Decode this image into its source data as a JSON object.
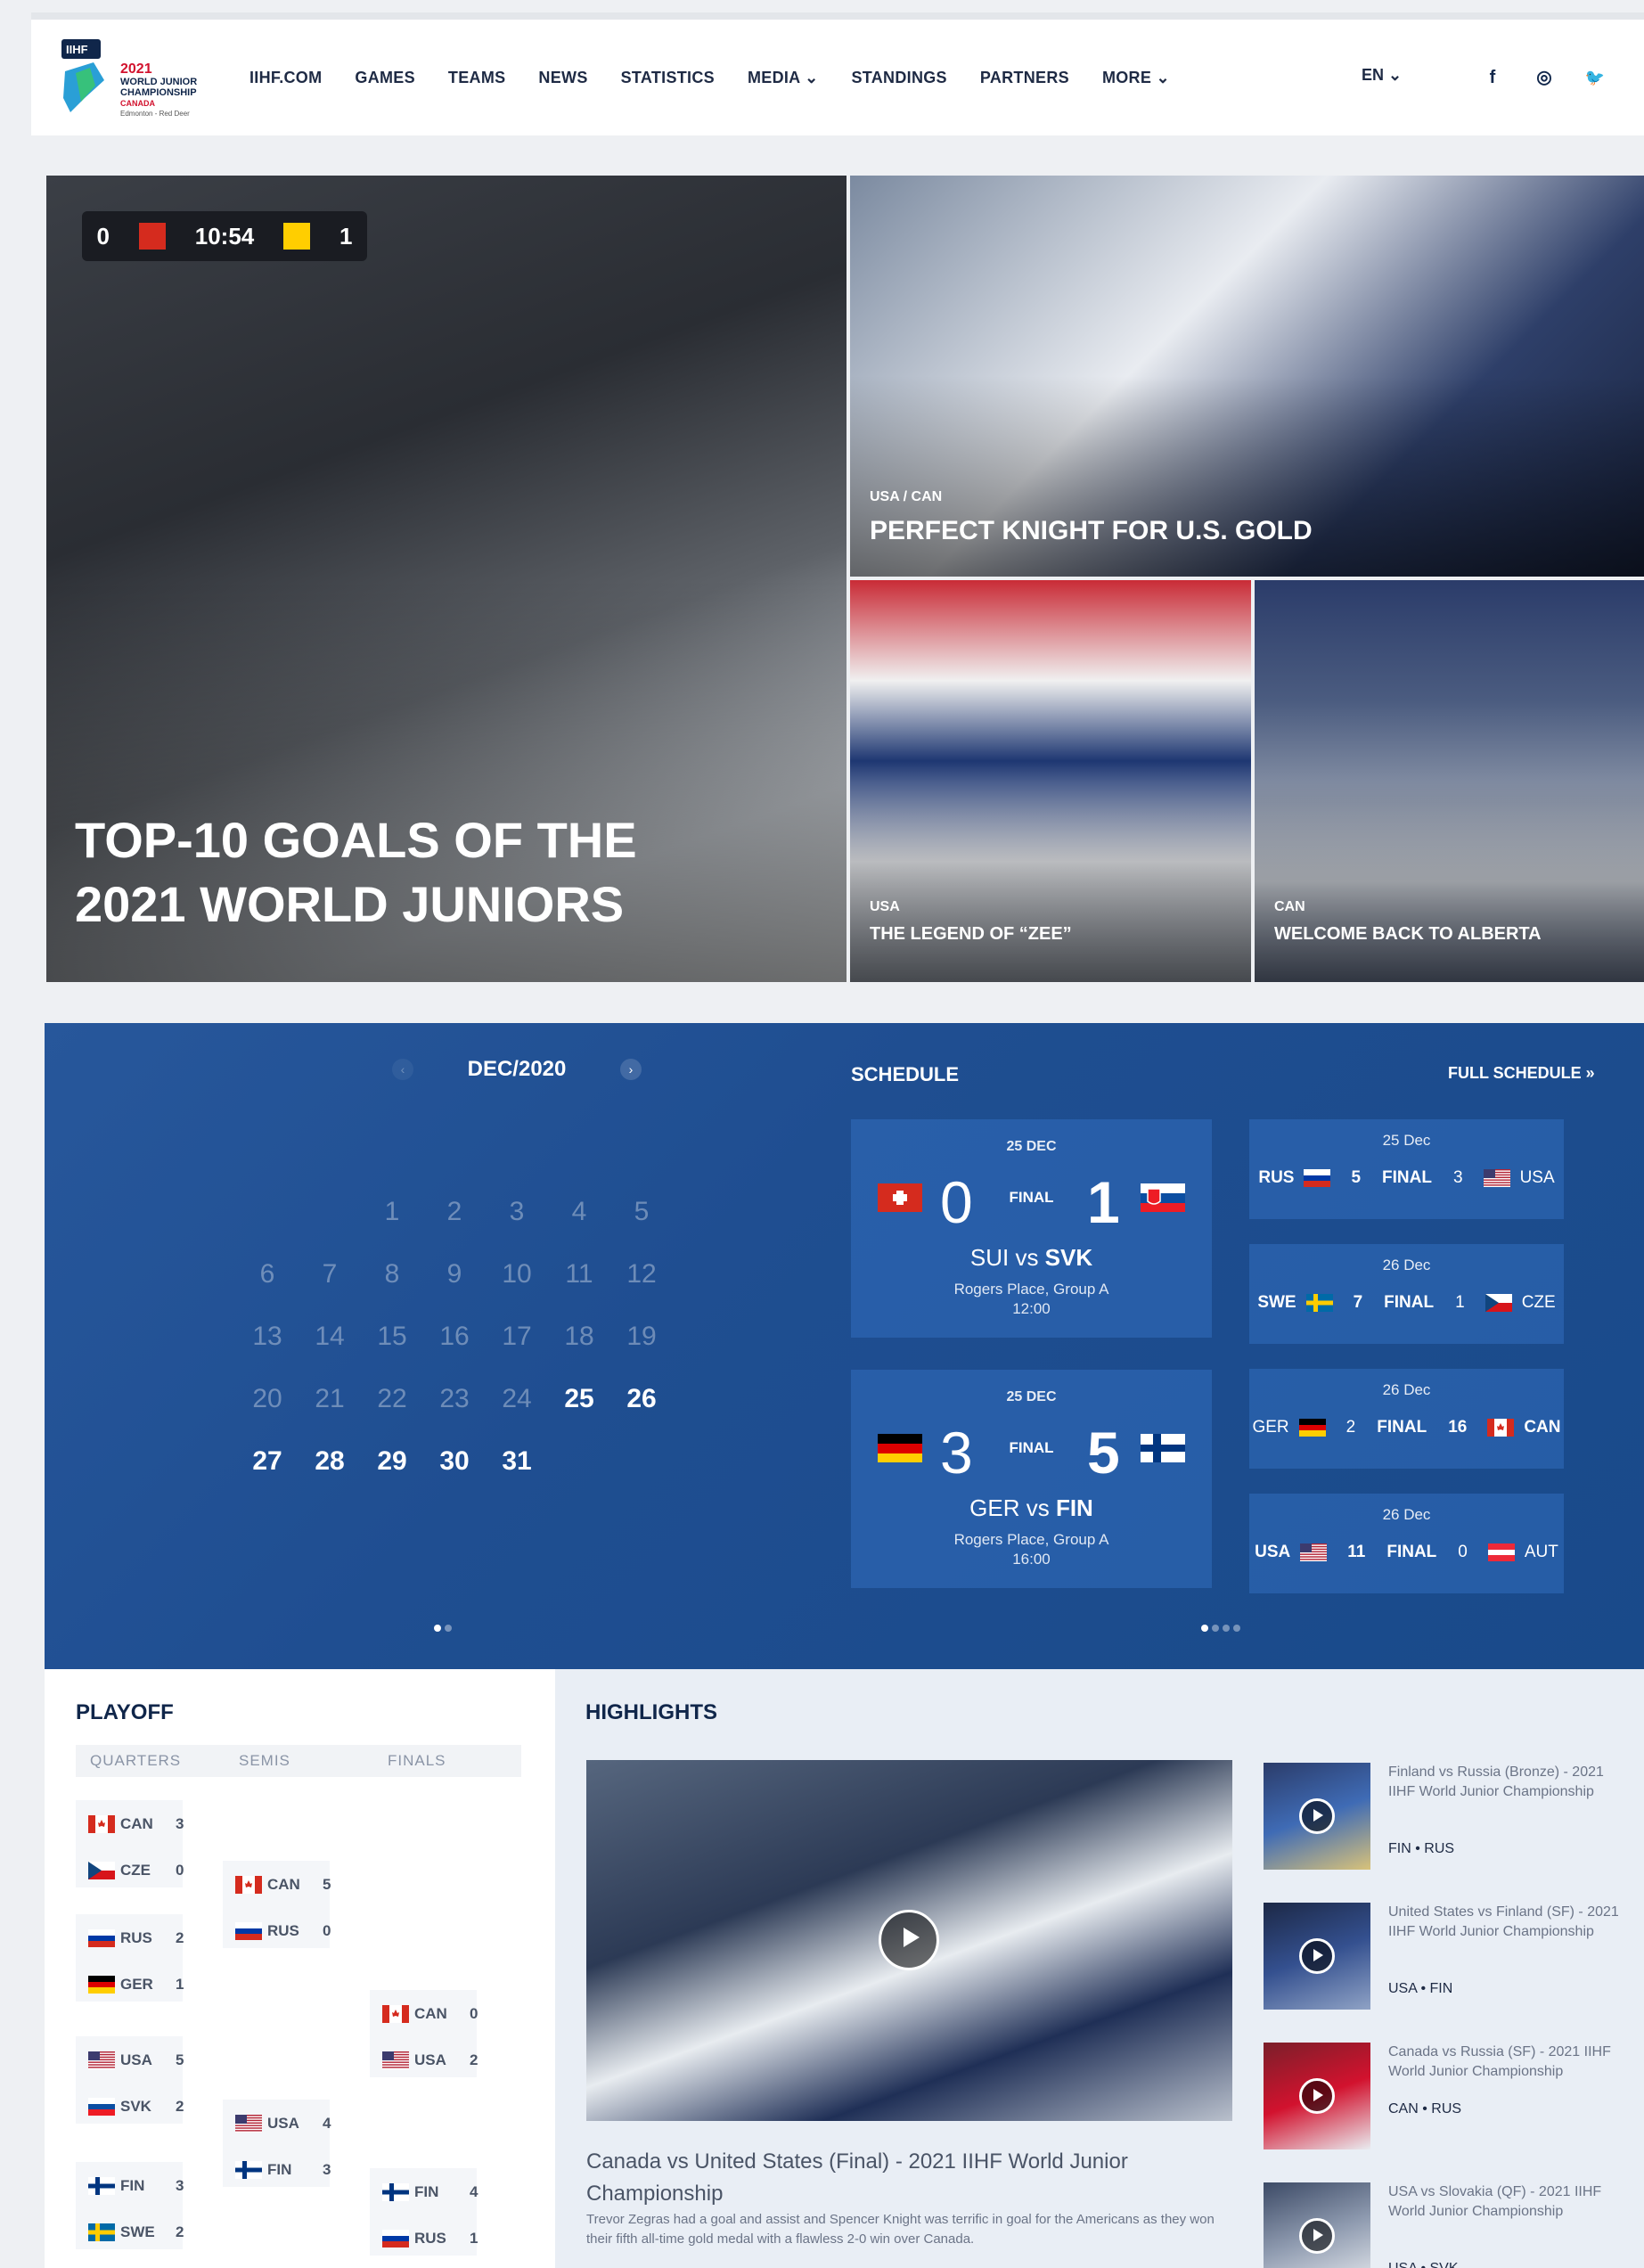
{
  "header": {
    "logo": {
      "year": "2021",
      "line1": "WORLD JUNIOR",
      "line2": "CHAMPIONSHIP",
      "country": "CANADA",
      "cities": "Edmonton - Red Deer",
      "badge": "IIHF"
    },
    "nav": [
      "IIHF.COM",
      "GAMES",
      "TEAMS",
      "NEWS",
      "STATISTICS",
      "MEDIA ⌄",
      "STANDINGS",
      "PARTNERS",
      "MORE ⌄"
    ],
    "lang": "EN ⌄",
    "social": [
      {
        "name": "facebook",
        "glyph": "f"
      },
      {
        "name": "instagram",
        "glyph": "◎"
      },
      {
        "name": "twitter",
        "glyph": "🐦"
      }
    ]
  },
  "hero": {
    "main": {
      "title": "TOP-10 GOALS OF THE 2021 WORLD JUNIORS",
      "scoreboard": {
        "left": "0",
        "time": "10:54",
        "right": "1"
      }
    },
    "top_right": {
      "tag": "USA / CAN",
      "title": "PERFECT KNIGHT FOR U.S. GOLD"
    },
    "bottom_left": {
      "tag": "USA",
      "title": "THE LEGEND OF “ZEE”"
    },
    "bottom_right": {
      "tag": "CAN",
      "title": "WELCOME BACK TO ALBERTA"
    }
  },
  "calendar": {
    "month": "DEC/2020",
    "prev": "‹",
    "next": "›",
    "rows": [
      [
        "",
        "",
        "1",
        "2",
        "3",
        "4",
        "5"
      ],
      [
        "6",
        "7",
        "8",
        "9",
        "10",
        "11",
        "12"
      ],
      [
        "13",
        "14",
        "15",
        "16",
        "17",
        "18",
        "19"
      ],
      [
        "20",
        "21",
        "22",
        "23",
        "24",
        "25",
        "26"
      ],
      [
        "27",
        "28",
        "29",
        "30",
        "31",
        "",
        ""
      ]
    ],
    "active_days": [
      "25",
      "26",
      "27",
      "28",
      "29",
      "30",
      "31"
    ]
  },
  "schedule": {
    "title": "SCHEDULE",
    "full_link": "FULL SCHEDULE »",
    "featured": [
      {
        "date": "25 DEC",
        "home_score": "0",
        "away_score": "1",
        "status": "FINAL",
        "home": "SUI",
        "vs": "vs",
        "away": "SVK",
        "venue": "Rogers Place, Group A",
        "time": "12:00",
        "home_colors": [
          "#d52b1e",
          "#ffffff"
        ],
        "away_colors": [
          "#ffffff",
          "#0b4ea2",
          "#ee1c25"
        ]
      },
      {
        "date": "25 DEC",
        "home_score": "3",
        "away_score": "5",
        "status": "FINAL",
        "home": "GER",
        "vs": "vs",
        "away": "FIN",
        "venue": "Rogers Place, Group A",
        "time": "16:00",
        "home_colors": [
          "#000000",
          "#dd0000",
          "#ffce00"
        ],
        "away_colors": [
          "#ffffff",
          "#003580"
        ]
      }
    ],
    "results": [
      {
        "date": "25 Dec",
        "home": "RUS",
        "home_score": "5",
        "status": "FINAL",
        "away_score": "3",
        "away": "USA",
        "winner": "home"
      },
      {
        "date": "26 Dec",
        "home": "SWE",
        "home_score": "7",
        "status": "FINAL",
        "away_score": "1",
        "away": "CZE",
        "winner": "home"
      },
      {
        "date": "26 Dec",
        "home": "GER",
        "home_score": "2",
        "status": "FINAL",
        "away_score": "16",
        "away": "CAN",
        "winner": "away"
      },
      {
        "date": "26 Dec",
        "home": "USA",
        "home_score": "11",
        "status": "FINAL",
        "away_score": "0",
        "away": "AUT",
        "winner": "home"
      }
    ]
  },
  "playoff": {
    "title": "PLAYOFF",
    "columns": [
      "QUARTERS",
      "SEMIS",
      "FINALS"
    ],
    "quarters": [
      [
        {
          "team": "CAN",
          "score": "3"
        },
        {
          "team": "CZE",
          "score": "0"
        }
      ],
      [
        {
          "team": "RUS",
          "score": "2"
        },
        {
          "team": "GER",
          "score": "1"
        }
      ],
      [
        {
          "team": "USA",
          "score": "5"
        },
        {
          "team": "SVK",
          "score": "2"
        }
      ],
      [
        {
          "team": "FIN",
          "score": "3"
        },
        {
          "team": "SWE",
          "score": "2"
        }
      ]
    ],
    "semis": [
      [
        {
          "team": "CAN",
          "score": "5"
        },
        {
          "team": "RUS",
          "score": "0"
        }
      ],
      [
        {
          "team": "USA",
          "score": "4"
        },
        {
          "team": "FIN",
          "score": "3"
        }
      ]
    ],
    "finals": [
      [
        {
          "team": "CAN",
          "score": "0"
        },
        {
          "team": "USA",
          "score": "2"
        }
      ],
      [
        {
          "team": "FIN",
          "score": "4"
        },
        {
          "team": "RUS",
          "score": "1"
        }
      ]
    ]
  },
  "highlights": {
    "title": "HIGHLIGHTS",
    "main": {
      "title": "Canada vs United States (Final) - 2021 IIHF World Junior Championship",
      "desc": "Trevor Zegras had a goal and assist and Spencer Knight was terrific in goal for the Americans as they won their fifth all-time gold medal with a flawless 2-0 win over Canada."
    },
    "list": [
      {
        "title": "Finland vs Russia (Bronze) - 2021 IIHF World Junior Championship",
        "teams": "FIN • RUS"
      },
      {
        "title": "United States vs Finland (SF) - 2021 IIHF World Junior Championship",
        "teams": "USA • FIN"
      },
      {
        "title": "Canada vs Russia (SF) - 2021 IIHF World Junior Championship",
        "teams": "CAN • RUS"
      },
      {
        "title": "USA vs Slovakia (QF) - 2021 IIHF World Junior Championship",
        "teams": "USA • SVK"
      }
    ]
  },
  "flags": {
    "CAN": [
      "#d52b1e",
      "#ffffff",
      "#d52b1e"
    ],
    "CZE": [
      "#ffffff",
      "#d7141a",
      "#11457e"
    ],
    "RUS": [
      "#ffffff",
      "#0039a6",
      "#d52b1e"
    ],
    "GER": [
      "#000000",
      "#dd0000",
      "#ffce00"
    ],
    "USA": [
      "#b22234",
      "#ffffff",
      "#3c3b6e"
    ],
    "SVK": [
      "#ffffff",
      "#0b4ea2",
      "#ee1c25"
    ],
    "FIN": [
      "#ffffff",
      "#003580",
      "#ffffff"
    ],
    "SWE": [
      "#006aa7",
      "#fecc00",
      "#006aa7"
    ],
    "SUI": [
      "#d52b1e",
      "#ffffff",
      "#d52b1e"
    ],
    "AUT": [
      "#ed2939",
      "#ffffff",
      "#ed2939"
    ]
  }
}
